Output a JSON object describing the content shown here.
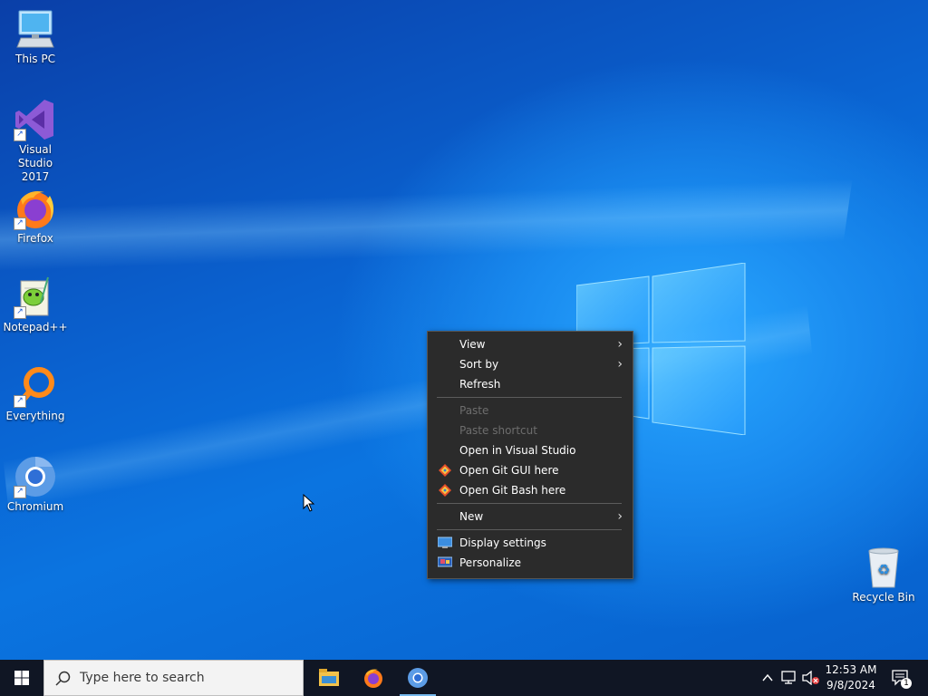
{
  "desktop": {
    "icons": [
      {
        "label_line1": "This PC",
        "label_line2": ""
      },
      {
        "label_line1": "Visual Studio",
        "label_line2": "2017"
      },
      {
        "label_line1": "Firefox",
        "label_line2": ""
      },
      {
        "label_line1": "Notepad++",
        "label_line2": ""
      },
      {
        "label_line1": "Everything",
        "label_line2": ""
      },
      {
        "label_line1": "Chromium",
        "label_line2": ""
      },
      {
        "label_line1": "Recycle Bin",
        "label_line2": ""
      }
    ]
  },
  "context_menu": {
    "items": [
      {
        "label": "View",
        "submenu": true,
        "enabled": true
      },
      {
        "label": "Sort by",
        "submenu": true,
        "enabled": true
      },
      {
        "label": "Refresh",
        "enabled": true
      },
      {
        "label": "Paste",
        "enabled": false
      },
      {
        "label": "Paste shortcut",
        "enabled": false
      },
      {
        "label": "Open in Visual Studio",
        "enabled": true
      },
      {
        "label": "Open Git GUI here",
        "enabled": true,
        "icon": "git-icon"
      },
      {
        "label": "Open Git Bash here",
        "enabled": true,
        "icon": "git-icon"
      },
      {
        "label": "New",
        "submenu": true,
        "enabled": true
      },
      {
        "label": "Display settings",
        "enabled": true,
        "icon": "display-icon"
      },
      {
        "label": "Personalize",
        "enabled": true,
        "icon": "personalize-icon"
      }
    ]
  },
  "taskbar": {
    "search_placeholder": "Type here to search",
    "pinned": [
      "file-explorer-icon",
      "firefox-icon",
      "chromium-icon"
    ],
    "clock_time": "12:53 AM",
    "clock_date": "9/8/2024",
    "notification_count": "1"
  },
  "colors": {
    "accent": "#0a6cd8",
    "menu_bg": "#2b2b2b",
    "taskbar_bg": "#101624"
  }
}
